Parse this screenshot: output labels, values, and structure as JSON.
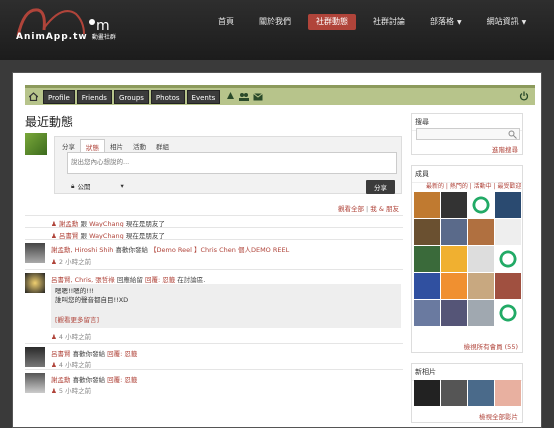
{
  "brand": {
    "name": "AnimApp.tw",
    "sub": "動畫社群"
  },
  "nav": [
    {
      "label": "首頁"
    },
    {
      "label": "關於我們"
    },
    {
      "label": "社群動態",
      "active": true
    },
    {
      "label": "社群討論"
    },
    {
      "label": "部落格",
      "caret": true
    },
    {
      "label": "網站資訊",
      "caret": true
    }
  ],
  "profile_tabs": [
    "Profile",
    "Friends",
    "Groups",
    "Photos",
    "Events"
  ],
  "page_title": "最近動態",
  "composer": {
    "tabs": [
      "分享",
      "狀態",
      "相片",
      "活動",
      "群組"
    ],
    "placeholder": "說出您內心想說的...",
    "privacy": "公開",
    "share_button": "分享"
  },
  "filter": {
    "all": "觀看全部",
    "sep": "|",
    "me_friends": "我 & 朋友"
  },
  "feed": [
    {
      "actor": "謝孟勳",
      "verb": "跟",
      "target": "WayChang",
      "rest": "現在是朋友了",
      "time": ""
    },
    {
      "actor": "呂書賢",
      "verb": "跟",
      "target": "WayChang",
      "rest": "現在是朋友了",
      "time": ""
    },
    {
      "actor": "謝孟勳, Hiroshi Shih",
      "verb": "喜歡你發給",
      "target": "【Demo Reel 】Chris Chen 個人DEMO REEL",
      "rest": "",
      "time": "2 小時之前"
    },
    {
      "actor": "呂書賢, Chris, 張哲祿",
      "verb": "回應給留",
      "target": "回覆: 忍籤",
      "rest": "在討論區.",
      "time": "4 小時之前",
      "comment": [
        "嗯嗯!!嗯的!!!",
        "誰叫您的聲音都自目!!XD"
      ],
      "more": "[觀看更多留言]"
    },
    {
      "actor": "呂書賢",
      "verb": "喜歡你發給",
      "target": "回覆: 忍籤",
      "rest": "",
      "time": "4 小時之前"
    },
    {
      "actor": "謝孟勳",
      "verb": "喜歡你發給",
      "target": "回覆: 忍籤",
      "rest": "",
      "time": "5 小時之前"
    }
  ],
  "sidebar": {
    "search_title": "搜尋",
    "advanced_search": "進階搜尋",
    "members_title": "成員",
    "member_tabs": "最新的 | 熱門的 | 活動中 | 最受歡迎",
    "all_members": "檢視所有會員 (55)",
    "photos_title": "新相片",
    "all_photos": "檢視全部影片"
  },
  "colors": {
    "accent": "#b0443a",
    "bar": "#b7c48b"
  }
}
